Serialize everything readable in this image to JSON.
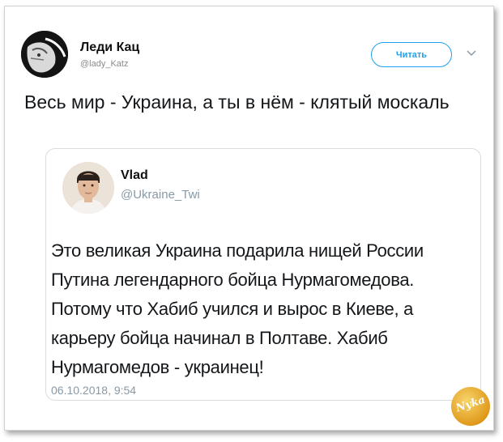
{
  "author": {
    "name": "Леди Кац",
    "handle": "@lady_Katz"
  },
  "follow_button_label": "Читать",
  "tweet_text": "Весь мир - Украина, а ты в нём - клятый москаль",
  "quoted": {
    "name": "Vlad",
    "handle": "@Ukraine_Twi",
    "text": "Это великая Украина подарила нищей России Путина легендарного бойца Нурмагомедова. Потому что Хабиб учился и вырос в Киеве, а карьеру бойца начинал в Полтаве. Хабиб Нурмагомедов - украинец!",
    "timestamp": "06.10.2018, 9:54"
  },
  "watermark": "Nyka",
  "colors": {
    "accent": "#1da1f2",
    "secondary_text": "#8899a6",
    "badge": "#e09a1c"
  },
  "icons": [
    "avatar",
    "chevron-down-icon",
    "watermark-badge"
  ]
}
